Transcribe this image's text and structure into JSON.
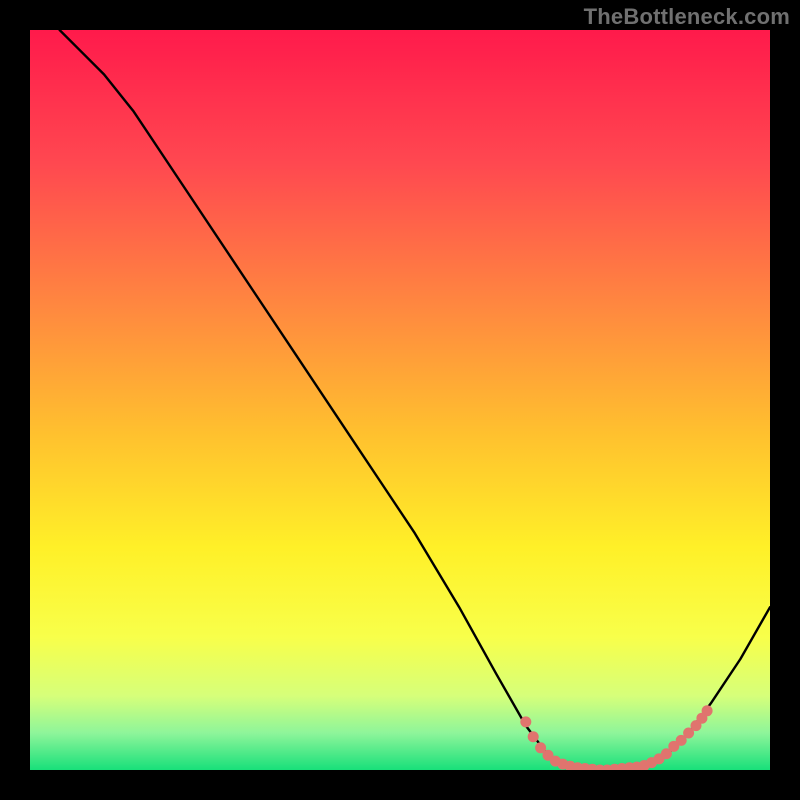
{
  "attribution": "TheBottleneck.com",
  "chart_data": {
    "type": "line",
    "title": "",
    "xlabel": "",
    "ylabel": "",
    "xlim": [
      0,
      100
    ],
    "ylim": [
      0,
      100
    ],
    "gradient_stops": [
      {
        "offset": 0,
        "color": "#ff1a4b"
      },
      {
        "offset": 18,
        "color": "#ff4850"
      },
      {
        "offset": 38,
        "color": "#ff8a3f"
      },
      {
        "offset": 55,
        "color": "#ffc22e"
      },
      {
        "offset": 70,
        "color": "#fff028"
      },
      {
        "offset": 82,
        "color": "#f8ff4a"
      },
      {
        "offset": 90,
        "color": "#d6ff7a"
      },
      {
        "offset": 95,
        "color": "#8ef59a"
      },
      {
        "offset": 100,
        "color": "#18e07a"
      }
    ],
    "curve_points": [
      {
        "x": 4,
        "y": 100
      },
      {
        "x": 7,
        "y": 97
      },
      {
        "x": 10,
        "y": 94
      },
      {
        "x": 14,
        "y": 89
      },
      {
        "x": 20,
        "y": 80
      },
      {
        "x": 28,
        "y": 68
      },
      {
        "x": 36,
        "y": 56
      },
      {
        "x": 44,
        "y": 44
      },
      {
        "x": 52,
        "y": 32
      },
      {
        "x": 58,
        "y": 22
      },
      {
        "x": 63,
        "y": 13
      },
      {
        "x": 67,
        "y": 6
      },
      {
        "x": 70,
        "y": 2
      },
      {
        "x": 73,
        "y": 0.5
      },
      {
        "x": 78,
        "y": 0
      },
      {
        "x": 83,
        "y": 0.5
      },
      {
        "x": 86,
        "y": 2
      },
      {
        "x": 89,
        "y": 5
      },
      {
        "x": 92,
        "y": 9
      },
      {
        "x": 96,
        "y": 15
      },
      {
        "x": 100,
        "y": 22
      }
    ],
    "markers": [
      {
        "x": 67,
        "y": 6.5
      },
      {
        "x": 68,
        "y": 4.5
      },
      {
        "x": 69,
        "y": 3
      },
      {
        "x": 70,
        "y": 2
      },
      {
        "x": 71,
        "y": 1.2
      },
      {
        "x": 72,
        "y": 0.8
      },
      {
        "x": 73,
        "y": 0.5
      },
      {
        "x": 74,
        "y": 0.3
      },
      {
        "x": 75,
        "y": 0.2
      },
      {
        "x": 76,
        "y": 0.1
      },
      {
        "x": 77,
        "y": 0
      },
      {
        "x": 78,
        "y": 0
      },
      {
        "x": 79,
        "y": 0.1
      },
      {
        "x": 80,
        "y": 0.2
      },
      {
        "x": 81,
        "y": 0.3
      },
      {
        "x": 82,
        "y": 0.4
      },
      {
        "x": 83,
        "y": 0.6
      },
      {
        "x": 84,
        "y": 1
      },
      {
        "x": 85,
        "y": 1.5
      },
      {
        "x": 86,
        "y": 2.2
      },
      {
        "x": 87,
        "y": 3.2
      },
      {
        "x": 88,
        "y": 4
      },
      {
        "x": 89,
        "y": 5
      },
      {
        "x": 90,
        "y": 6
      },
      {
        "x": 90.8,
        "y": 7
      },
      {
        "x": 91.5,
        "y": 8
      }
    ],
    "marker_radius": 5.5
  }
}
